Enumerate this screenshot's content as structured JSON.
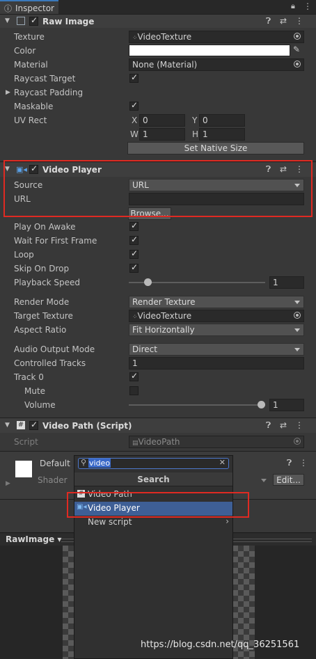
{
  "tab": {
    "title": "Inspector"
  },
  "raw_image": {
    "title": "Raw Image",
    "texture_label": "Texture",
    "texture_value": "VideoTexture",
    "color_label": "Color",
    "material_label": "Material",
    "material_value": "None (Material)",
    "raycast_target_label": "Raycast Target",
    "raycast_padding_label": "Raycast Padding",
    "maskable_label": "Maskable",
    "uv_rect_label": "UV Rect",
    "uv_x_label": "X",
    "uv_x": "0",
    "uv_y_label": "Y",
    "uv_y": "0",
    "uv_w_label": "W",
    "uv_w": "1",
    "uv_h_label": "H",
    "uv_h": "1",
    "native_size_button": "Set Native Size"
  },
  "video_player": {
    "title": "Video Player",
    "source_label": "Source",
    "source_value": "URL",
    "url_label": "URL",
    "url_value": "",
    "browse_button": "Browse...",
    "play_on_awake_label": "Play On Awake",
    "wait_first_frame_label": "Wait For First Frame",
    "loop_label": "Loop",
    "skip_on_drop_label": "Skip On Drop",
    "playback_speed_label": "Playback Speed",
    "playback_speed_value": "1",
    "playback_speed_level": 0.12,
    "render_mode_label": "Render Mode",
    "render_mode_value": "Render Texture",
    "target_texture_label": "Target Texture",
    "target_texture_value": "VideoTexture",
    "aspect_ratio_label": "Aspect Ratio",
    "aspect_ratio_value": "Fit Horizontally",
    "audio_output_label": "Audio Output Mode",
    "audio_output_value": "Direct",
    "controlled_tracks_label": "Controlled Tracks",
    "controlled_tracks_value": "1",
    "track0_label": "Track 0",
    "mute_label": "Mute",
    "volume_label": "Volume",
    "volume_value": "1",
    "volume_level": 1.0
  },
  "video_path": {
    "title": "Video Path (Script)",
    "script_label": "Script",
    "script_value": "VideoPath"
  },
  "material": {
    "name": "Default",
    "shader_label": "Shader",
    "edit_button": "Edit..."
  },
  "add_component_popup": {
    "search_value": "video",
    "header": "Search",
    "items": [
      "Video Path",
      "Video Player",
      "New script"
    ]
  },
  "preview": {
    "title": "RawImage"
  },
  "watermark": "https://blog.csdn.net/qq_36251561",
  "colors": {
    "accent_selected": "#3e5f96",
    "highlight_red": "#e02a22",
    "panel_bg": "#383838"
  }
}
